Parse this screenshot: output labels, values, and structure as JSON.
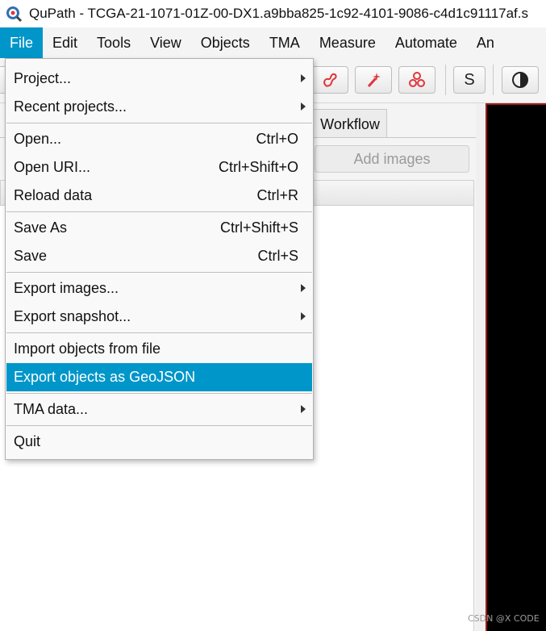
{
  "window": {
    "title": "QuPath - TCGA-21-1071-01Z-00-DX1.a9bba825-1c92-4101-9086-c4d1c91117af.s",
    "app_icon": "qupath-logo-icon"
  },
  "menubar": {
    "items": [
      {
        "label": "File"
      },
      {
        "label": "Edit"
      },
      {
        "label": "Tools"
      },
      {
        "label": "View"
      },
      {
        "label": "Objects"
      },
      {
        "label": "TMA"
      },
      {
        "label": "Measure"
      },
      {
        "label": "Automate"
      },
      {
        "label": "An"
      }
    ],
    "active": "File"
  },
  "toolbar": {
    "buttons": [
      {
        "icon": "polyline-tool-icon"
      },
      {
        "icon": "wand-tool-icon"
      },
      {
        "icon": "points-tool-icon"
      },
      {
        "icon": "selection-mode-icon",
        "label": "S"
      },
      {
        "icon": "brightness-contrast-icon"
      }
    ],
    "accent_color": "#e0353a"
  },
  "left_pane": {
    "tab_workflow": "Workflow",
    "add_images_label": "Add images"
  },
  "file_menu": {
    "items": [
      {
        "label": "Project...",
        "shortcut": "",
        "submenu": true
      },
      {
        "label": "Recent projects...",
        "shortcut": "",
        "submenu": true
      },
      {
        "label": "Open...",
        "shortcut": "Ctrl+O",
        "submenu": false
      },
      {
        "label": "Open URI...",
        "shortcut": "Ctrl+Shift+O",
        "submenu": false
      },
      {
        "label": "Reload data",
        "shortcut": "Ctrl+R",
        "submenu": false
      },
      {
        "label": "Save As",
        "shortcut": "Ctrl+Shift+S",
        "submenu": false
      },
      {
        "label": "Save",
        "shortcut": "Ctrl+S",
        "submenu": false
      },
      {
        "label": "Export images...",
        "shortcut": "",
        "submenu": true
      },
      {
        "label": "Export snapshot...",
        "shortcut": "",
        "submenu": true
      },
      {
        "label": "Import objects from file",
        "shortcut": "",
        "submenu": false
      },
      {
        "label": "Export objects as GeoJSON",
        "shortcut": "",
        "submenu": false,
        "highlighted": true
      },
      {
        "label": "TMA data...",
        "shortcut": "",
        "submenu": true
      },
      {
        "label": "Quit",
        "shortcut": "",
        "submenu": false
      }
    ],
    "highlight_color": "#0096c9"
  },
  "watermark": "CSDN @X CODE"
}
